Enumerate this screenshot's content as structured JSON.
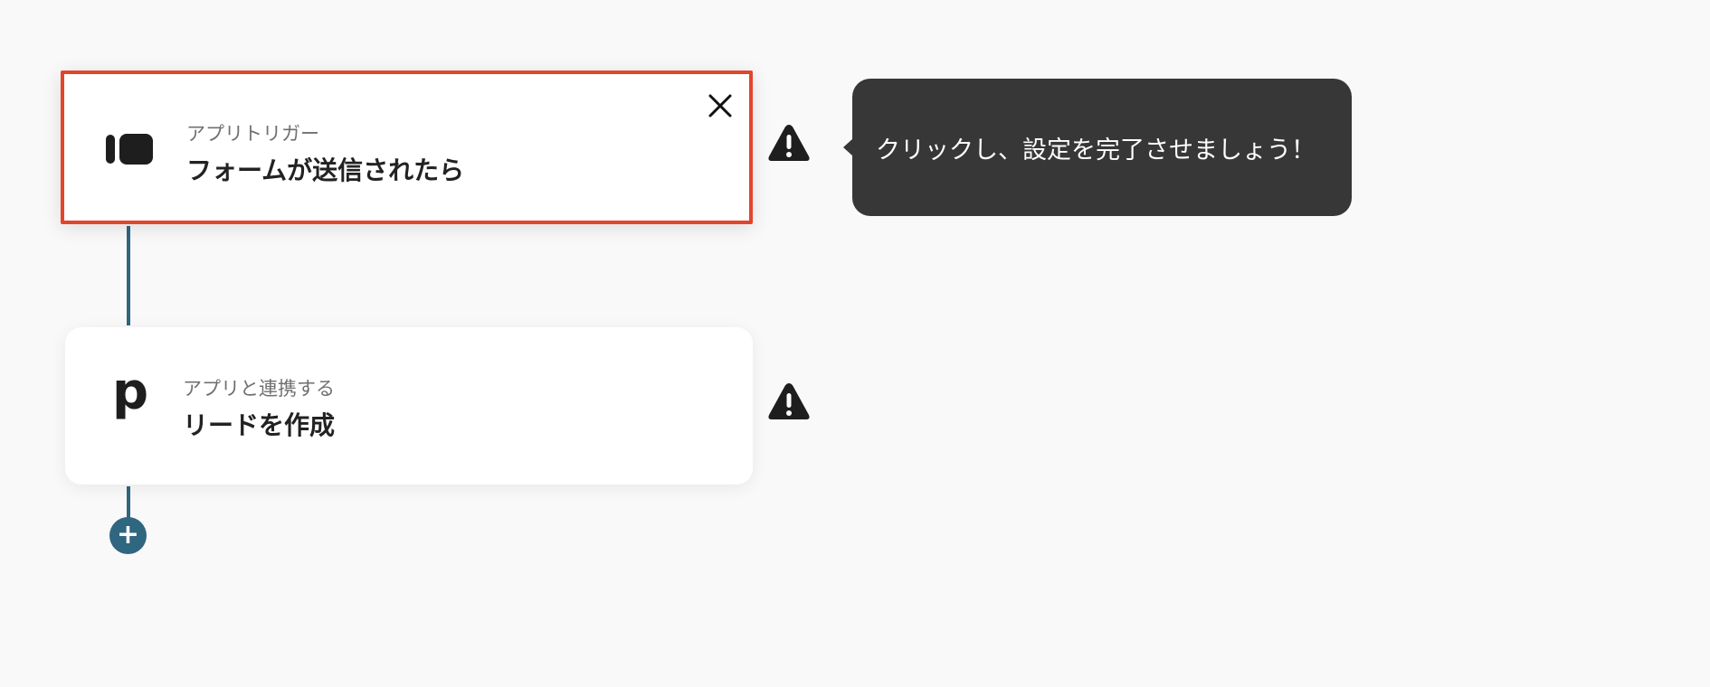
{
  "steps": [
    {
      "subtitle": "アプリトリガー",
      "title": "フォームが送信されたら",
      "icon": "form-app-icon",
      "warning": "warning-icon"
    },
    {
      "subtitle": "アプリと連携する",
      "title": "リードを作成",
      "icon_glyph": "p",
      "icon": "pipedrive-icon",
      "warning": "warning-icon"
    }
  ],
  "tooltip": {
    "text": "クリックし、設定を完了させましょう！"
  },
  "add_button": {
    "label": "+",
    "icon": "plus-icon"
  },
  "colors": {
    "active_border": "#e1452c",
    "connector": "#2f6680",
    "tooltip_bg": "#373737"
  }
}
